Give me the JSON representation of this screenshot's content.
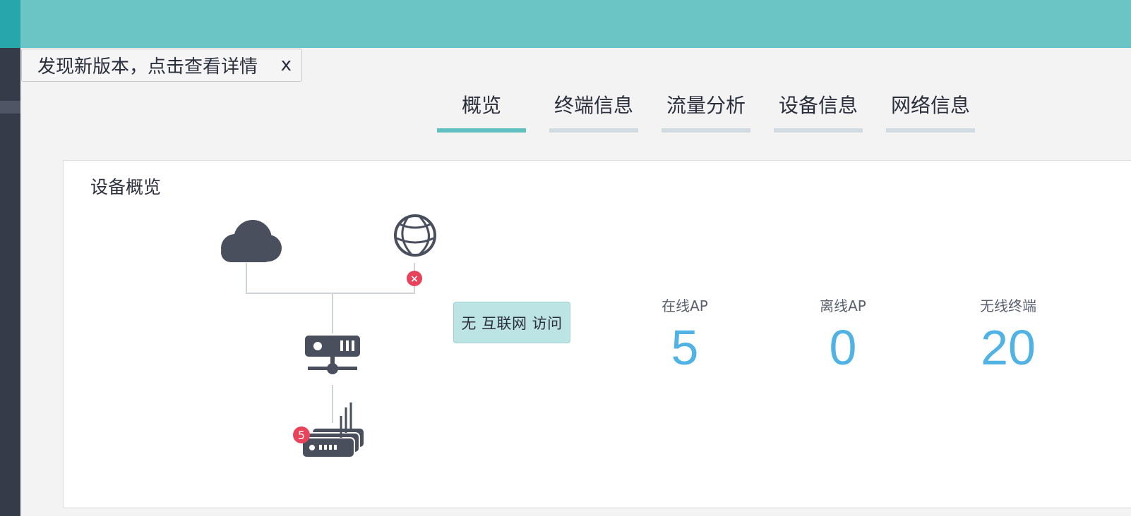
{
  "notice": {
    "text": "发现新版本，点击查看详情",
    "close": "x"
  },
  "tabs": [
    {
      "label": "概览",
      "active": true
    },
    {
      "label": "终端信息",
      "active": false
    },
    {
      "label": "流量分析",
      "active": false
    },
    {
      "label": "设备信息",
      "active": false
    },
    {
      "label": "网络信息",
      "active": false
    }
  ],
  "overview": {
    "title": "设备概览",
    "diagram": {
      "error_badge": "×",
      "ap_badge": "5",
      "tooltip": "无 互联网 访问"
    },
    "stats": [
      {
        "label": "在线AP",
        "value": "5"
      },
      {
        "label": "离线AP",
        "value": "0"
      },
      {
        "label": "无线终端",
        "value": "20"
      }
    ]
  },
  "colors": {
    "header": "#6bc5c5",
    "sidebar": "#363b49",
    "accent": "#50b3e3",
    "tab_active": "#5fc0bf",
    "error": "#e8435a"
  }
}
